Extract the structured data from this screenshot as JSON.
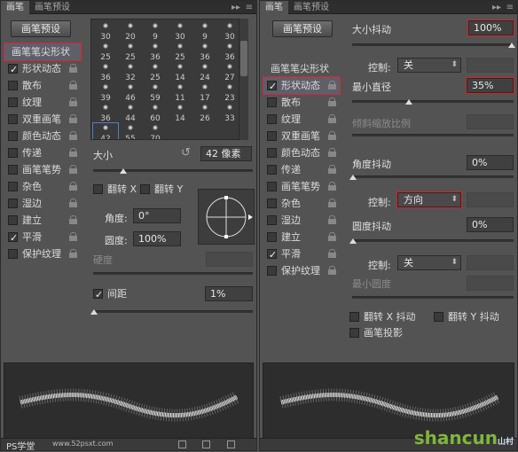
{
  "left": {
    "tabs": [
      "画笔",
      "画笔预设"
    ],
    "preset_button": "画笔预设",
    "options": [
      {
        "label": "画笔笔尖形状",
        "checked": false,
        "lock": false,
        "selected": true
      },
      {
        "label": "形状动态",
        "checked": true,
        "lock": true
      },
      {
        "label": "散布",
        "checked": false,
        "lock": true
      },
      {
        "label": "纹理",
        "checked": false,
        "lock": true
      },
      {
        "label": "双重画笔",
        "checked": false,
        "lock": true
      },
      {
        "label": "颜色动态",
        "checked": false,
        "lock": true
      },
      {
        "label": "传递",
        "checked": false,
        "lock": true
      },
      {
        "label": "画笔笔势",
        "checked": false,
        "lock": true
      },
      {
        "label": "杂色",
        "checked": false,
        "lock": true
      },
      {
        "label": "湿边",
        "checked": false,
        "lock": true
      },
      {
        "label": "建立",
        "checked": false,
        "lock": true
      },
      {
        "label": "平滑",
        "checked": true,
        "lock": true
      },
      {
        "label": "保护纹理",
        "checked": false,
        "lock": true
      }
    ],
    "brush_sizes": [
      "30",
      "20",
      "9",
      "30",
      "9",
      "30",
      "25",
      "25",
      "36",
      "25",
      "36",
      "36",
      "36",
      "32",
      "25",
      "14",
      "24",
      "27",
      "39",
      "46",
      "59",
      "11",
      "17",
      "23",
      "36",
      "44",
      "60",
      "14",
      "26",
      "33",
      "42",
      "55",
      "70"
    ],
    "size_label": "大小",
    "size_value": "42 像素",
    "flip_x": "翻转 X",
    "flip_y": "翻转 Y",
    "angle_label": "角度:",
    "angle_value": "0°",
    "round_label": "圆度:",
    "round_value": "100%",
    "hardness_label": "硬度",
    "spacing_label": "间距",
    "spacing_value": "1%",
    "spacing_checked": true
  },
  "right": {
    "tabs": [
      "画笔",
      "画笔预设"
    ],
    "preset_button": "画笔预设",
    "options": [
      {
        "label": "画笔笔尖形状",
        "checked": false,
        "lock": false
      },
      {
        "label": "形状动态",
        "checked": true,
        "lock": true,
        "selected": true
      },
      {
        "label": "散布",
        "checked": false,
        "lock": true
      },
      {
        "label": "纹理",
        "checked": false,
        "lock": true
      },
      {
        "label": "双重画笔",
        "checked": false,
        "lock": true
      },
      {
        "label": "颜色动态",
        "checked": false,
        "lock": true
      },
      {
        "label": "传递",
        "checked": false,
        "lock": true
      },
      {
        "label": "画笔笔势",
        "checked": false,
        "lock": true
      },
      {
        "label": "杂色",
        "checked": false,
        "lock": true
      },
      {
        "label": "湿边",
        "checked": false,
        "lock": true
      },
      {
        "label": "建立",
        "checked": false,
        "lock": true
      },
      {
        "label": "平滑",
        "checked": true,
        "lock": true
      },
      {
        "label": "保护纹理",
        "checked": false,
        "lock": true
      }
    ],
    "size_jitter_label": "大小抖动",
    "size_jitter_value": "100%",
    "control_label": "控制:",
    "control1_value": "关",
    "min_diameter_label": "最小直径",
    "min_diameter_value": "35%",
    "tilt_label": "倾斜缩放比例",
    "angle_jitter_label": "角度抖动",
    "angle_jitter_value": "0%",
    "control2_value": "方向",
    "round_jitter_label": "圆度抖动",
    "round_jitter_value": "0%",
    "control3_value": "关",
    "min_round_label": "最小圆度",
    "flip_x_jitter": "翻转 X 抖动",
    "flip_y_jitter": "翻转 Y 抖动",
    "brush_projection": "画笔投影"
  },
  "watermark": {
    "left": "PS学堂",
    "url": "www.52psxt.com",
    "brand": "shancun",
    "brand_sub": "山村"
  }
}
